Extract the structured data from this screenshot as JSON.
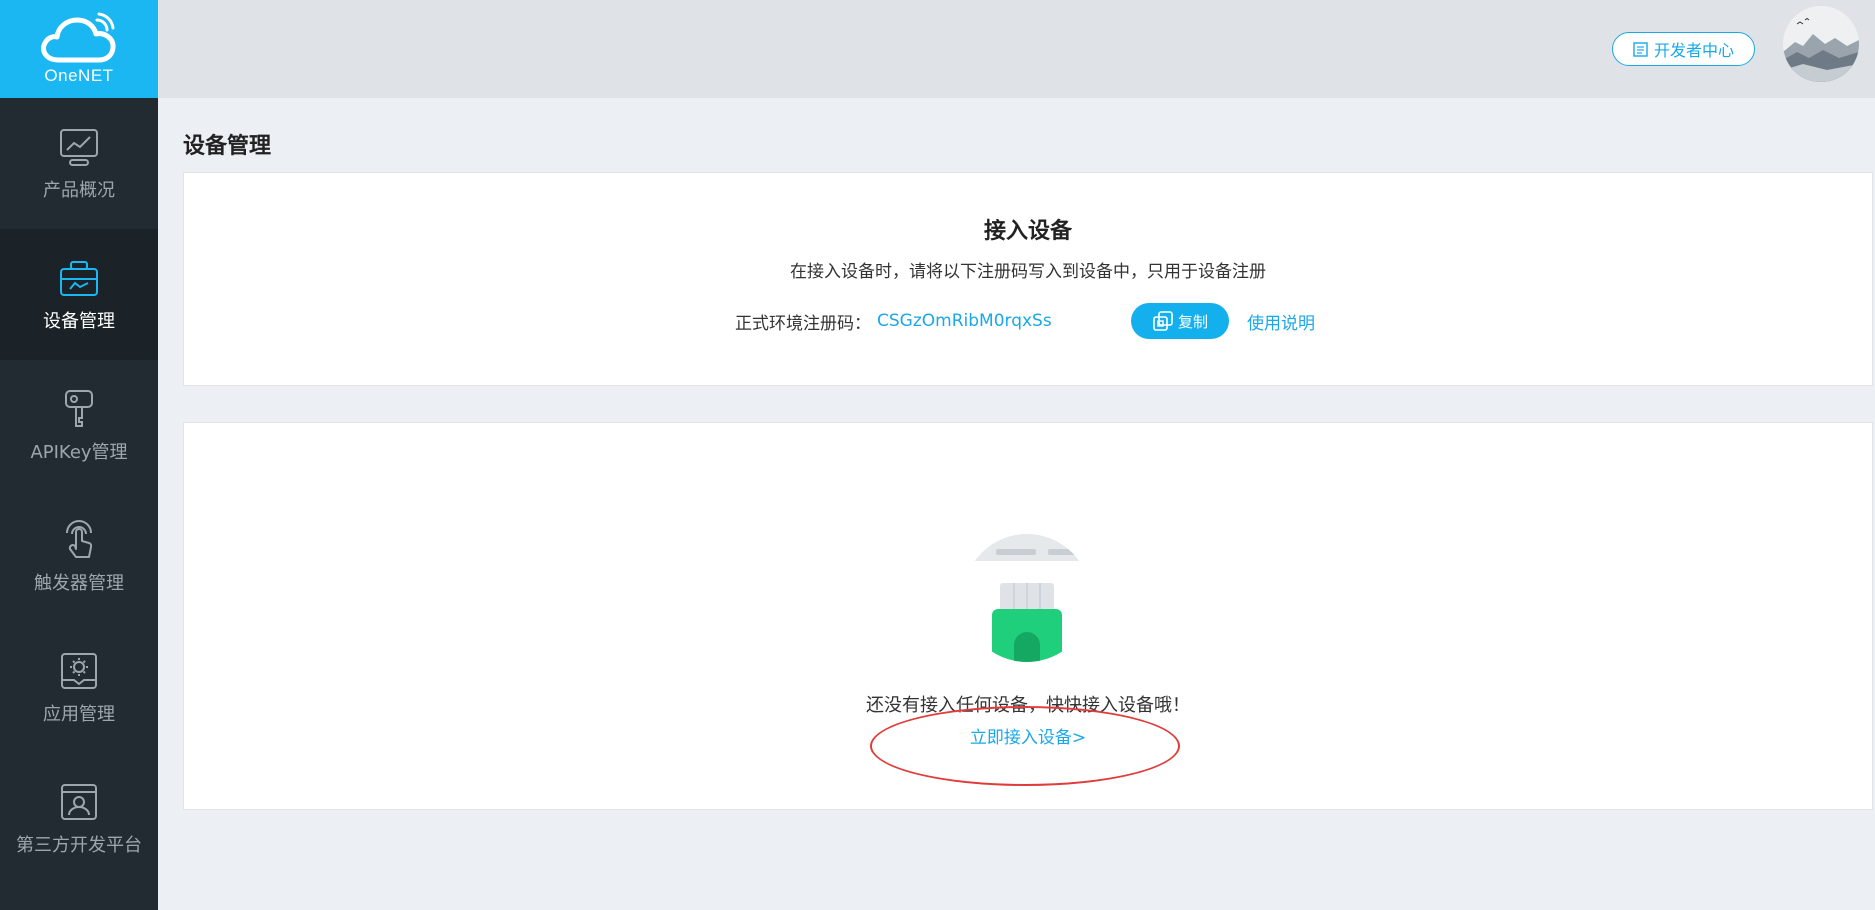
{
  "brand": {
    "name": "OneNET",
    "accent": "#1bb7f2"
  },
  "sidebar": {
    "items": [
      {
        "label": "产品概况",
        "icon": "chart-monitor-icon",
        "active": false
      },
      {
        "label": "设备管理",
        "icon": "toolbox-icon",
        "active": true
      },
      {
        "label": "APIKey管理",
        "icon": "key-icon",
        "active": false
      },
      {
        "label": "触发器管理",
        "icon": "touch-hand-icon",
        "active": false
      },
      {
        "label": "应用管理",
        "icon": "app-gear-icon",
        "active": false
      },
      {
        "label": "第三方开发平台",
        "icon": "user-window-icon",
        "active": false
      }
    ]
  },
  "header": {
    "dev_center_label": "开发者中心",
    "dev_center_icon": "document-icon"
  },
  "page": {
    "title": "设备管理"
  },
  "register_card": {
    "title": "接入设备",
    "subtitle": "在接入设备时，请将以下注册码写入到设备中，只用于设备注册",
    "code_label": "正式环境注册码：",
    "code_value": "CSGzOmRibM0rqxSs",
    "copy_label": "复制",
    "usage_link": "使用说明"
  },
  "empty_card": {
    "message": "还没有接入任何设备，快快接入设备哦！",
    "connect_link": "立即接入设备>"
  },
  "colors": {
    "link": "#1aa8e8",
    "sidebar_bg": "#232b32",
    "annotation": "#e03c3c"
  }
}
